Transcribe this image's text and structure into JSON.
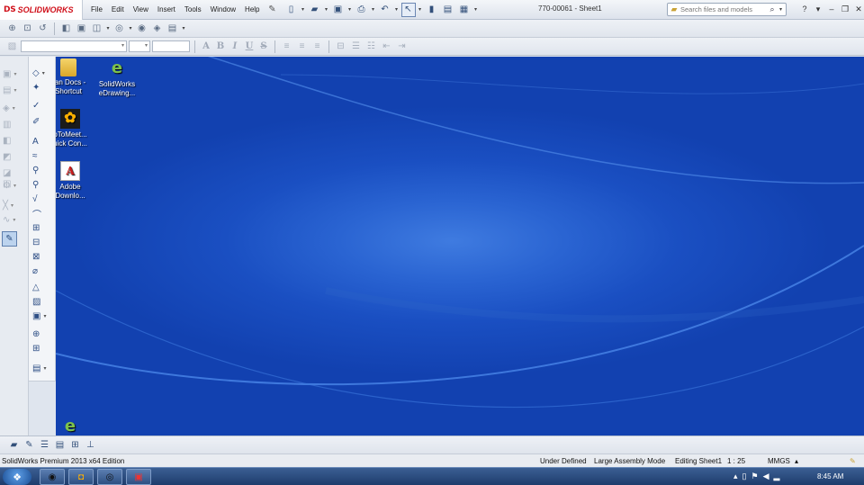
{
  "app": {
    "logo_mark": "DS",
    "logo_text": "SOLIDWORKS",
    "document_title": "770-00061 - Sheet1"
  },
  "menu": [
    "File",
    "Edit",
    "View",
    "Insert",
    "Tools",
    "Window",
    "Help"
  ],
  "search": {
    "placeholder": "Search files and models"
  },
  "desktop_icons": [
    {
      "label_line1": "can Docs -",
      "label_line2": "Shortcut",
      "icon": "folder-icon"
    },
    {
      "label_line1": "SolidWorks",
      "label_line2": "eDrawing...",
      "icon": "edrawings-icon"
    },
    {
      "label_line1": "oToMeet...",
      "label_line2": "uick Con...",
      "icon": "gotomeeting-icon"
    },
    {
      "label_line1": "Adobe",
      "label_line2": "Downlo...",
      "icon": "adobe-icon"
    }
  ],
  "status": {
    "edition": "SolidWorks Premium 2013 x64 Edition",
    "defined": "Under Defined",
    "mode": "Large Assembly Mode",
    "editing": "Editing Sheet1",
    "scale": "1 : 25",
    "units": "MMGS"
  },
  "taskbar": {
    "clock": "8:45 AM"
  },
  "colors": {
    "desktop": "#1a4fc2",
    "brand": "#d0101a",
    "taskbar": "#1e3c6c"
  }
}
